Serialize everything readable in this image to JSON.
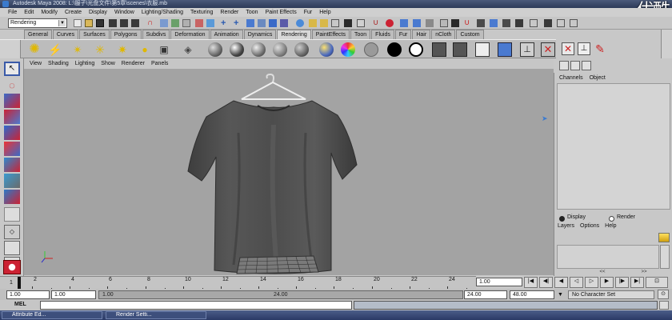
{
  "window": {
    "title": "Autodesk Maya 2008: L:\\服子\\光盘文件\\第5章\\scenes\\衣服.mb"
  },
  "watermark": "优酷",
  "menubar": [
    "File",
    "Edit",
    "Modify",
    "Create",
    "Display",
    "Window",
    "Lighting/Shading",
    "Texturing",
    "Render",
    "Toon",
    "Paint Effects",
    "Fur",
    "Help"
  ],
  "statusline": {
    "mode": "Rendering"
  },
  "shelf_tabs": [
    "General",
    "Curves",
    "Surfaces",
    "Polygons",
    "Subdivs",
    "Deformation",
    "Animation",
    "Dynamics",
    "Rendering",
    "PaintEffects",
    "Toon",
    "Fluids",
    "Fur",
    "Hair",
    "nCloth",
    "Custom"
  ],
  "active_shelf_tab": "Rendering",
  "viewport": {
    "menu": [
      "View",
      "Shading",
      "Lighting",
      "Show",
      "Renderer",
      "Panels"
    ],
    "background": "#a3a3a3",
    "object_color": "#4a4a4a"
  },
  "channel_box": {
    "menu": [
      "Channels",
      "Object"
    ]
  },
  "layer_editor": {
    "display_label": "Display",
    "render_label": "Render",
    "menu": [
      "Layers",
      "Options",
      "Help"
    ]
  },
  "time_slider": {
    "ticks": [
      "2",
      "4",
      "6",
      "8",
      "10",
      "12",
      "14",
      "16",
      "18",
      "20",
      "22",
      "24"
    ],
    "current_frame": "1",
    "current_frame_field": "1.00"
  },
  "range_slider": {
    "start": "1.00",
    "playback_start": "1.00",
    "range_label": "1.00",
    "range_end_label": "24.00",
    "playback_end": "24.00",
    "end": "48.00",
    "character_set": "No Character Set"
  },
  "command_line": {
    "label": "MEL"
  },
  "taskbar": {
    "items": [
      "Attribute Ed...",
      "Render Setti..."
    ]
  }
}
